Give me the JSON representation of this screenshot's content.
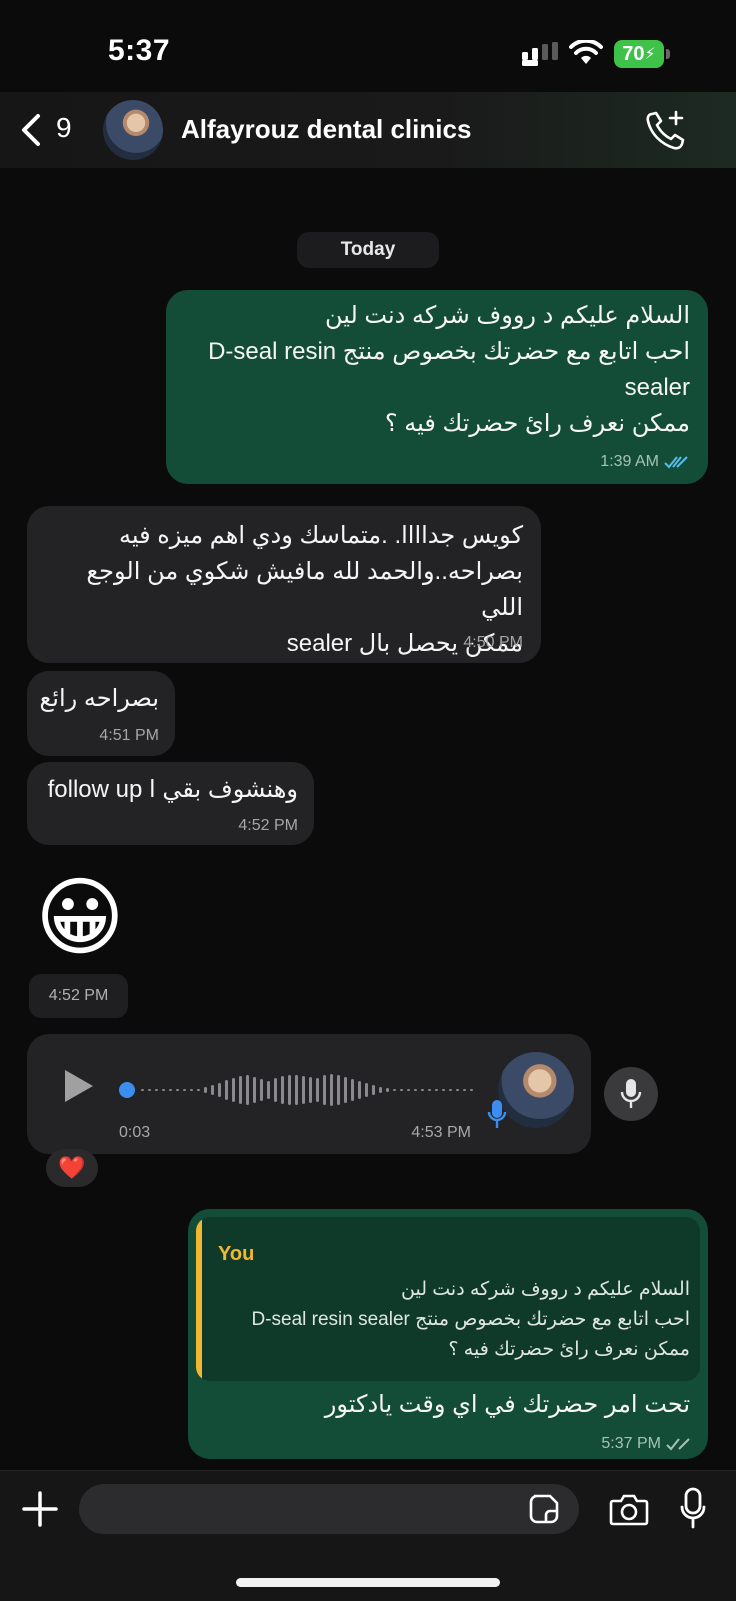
{
  "status_bar": {
    "time": "5:37",
    "battery": "70"
  },
  "header": {
    "back_count": "9",
    "title": "Alfayrouz dental clinics",
    "call_icon": "phone-add-icon"
  },
  "date_chip": "Today",
  "messages": [
    {
      "direction": "out",
      "lines": [
        "السلام عليكم د رووف شركه دنت لين",
        "احب اتابع مع حضرتك بخصوص منتج D-seal resin",
        "sealer",
        "ممكن نعرف رائ حضرتك فيه ؟"
      ],
      "time": "1:39 AM",
      "status": "read"
    },
    {
      "direction": "in",
      "lines": [
        "كويس جداااا. .متماسك ودي اهم ميزه فيه",
        "بصراحه..والحمد لله مافيش شكوي من الوجع اللي",
        "ممكن يحصل بال sealer"
      ],
      "time": "4:50 PM"
    },
    {
      "direction": "in",
      "lines": [
        "بصراحه رائع"
      ],
      "time": "4:51 PM"
    },
    {
      "direction": "in",
      "lines": [
        "وهنشوف بقي ا follow up"
      ],
      "time": "4:52 PM"
    }
  ],
  "emoji_message": {
    "emoji": "😀",
    "time": "4:52 PM"
  },
  "voice_note": {
    "duration": "0:03",
    "time": "4:53 PM",
    "progress": 0.0,
    "reaction": "❤️"
  },
  "reply_message": {
    "quote_author": "You",
    "quote_lines": [
      "السلام عليكم د رووف شركه دنت لين",
      "احب اتابع مع حضرتك بخصوص منتج D-seal resin sealer",
      "ممكن نعرف رائ حضرتك فيه ؟"
    ],
    "text": "تحت امر حضرتك في اي وقت يادكتور",
    "time": "5:37 PM",
    "status": "delivered"
  },
  "composer": {
    "placeholder": ""
  },
  "colors": {
    "outgoing_bubble": "#144d37",
    "incoming_bubble": "#232325",
    "read_tick": "#53bdeb",
    "quote_accent": "#f2b731"
  }
}
